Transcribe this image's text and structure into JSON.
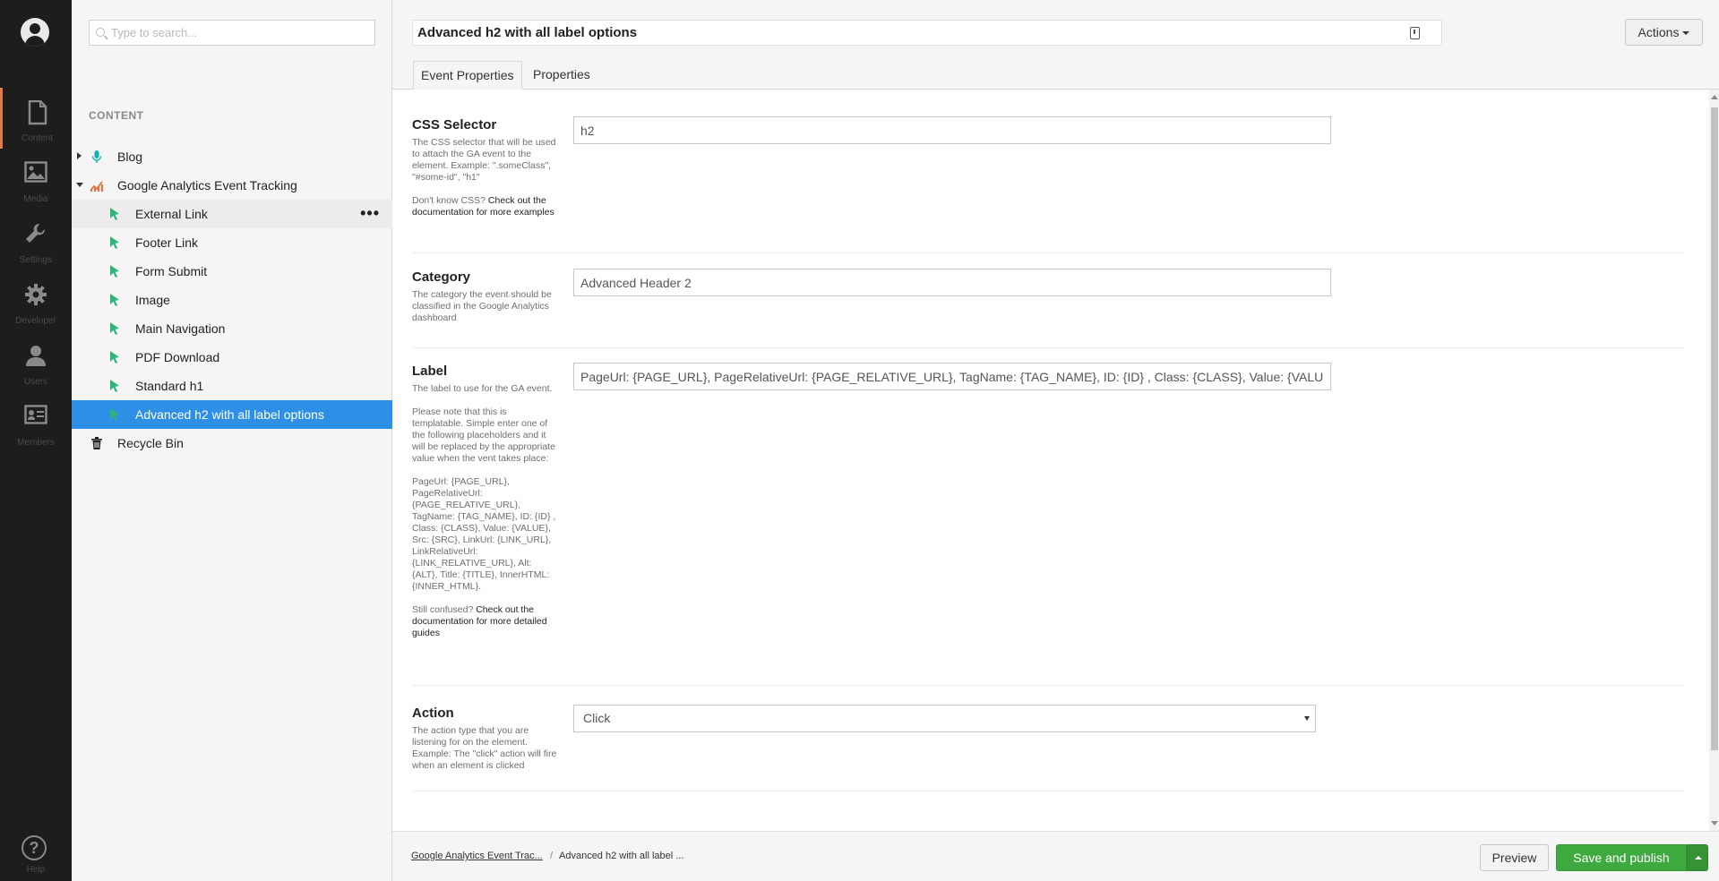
{
  "nav": {
    "items": [
      {
        "label": "Content",
        "icon": "document-icon"
      },
      {
        "label": "Media",
        "icon": "image-icon"
      },
      {
        "label": "Settings",
        "icon": "wrench-icon"
      },
      {
        "label": "Developer",
        "icon": "gear-icon"
      },
      {
        "label": "Users",
        "icon": "user-icon"
      },
      {
        "label": "Members",
        "icon": "id-card-icon"
      }
    ],
    "help_label": "Help",
    "help_glyph": "?"
  },
  "tree": {
    "search_placeholder": "Type to search...",
    "section_title": "CONTENT",
    "nodes": [
      {
        "label": "Blog",
        "icon": "microphone-icon"
      },
      {
        "label": "Google Analytics Event Tracking",
        "icon": "chart-icon"
      },
      {
        "label": "External Link",
        "icon": "cursor-icon"
      },
      {
        "label": "Footer Link",
        "icon": "cursor-icon"
      },
      {
        "label": "Form Submit",
        "icon": "cursor-icon"
      },
      {
        "label": "Image",
        "icon": "cursor-icon"
      },
      {
        "label": "Main Navigation",
        "icon": "cursor-icon"
      },
      {
        "label": "PDF Download",
        "icon": "cursor-icon"
      },
      {
        "label": "Standard h1",
        "icon": "cursor-icon"
      },
      {
        "label": "Advanced h2 with all label options",
        "icon": "cursor-icon"
      },
      {
        "label": "Recycle Bin",
        "icon": "trash-icon"
      }
    ],
    "more_glyph": "•••"
  },
  "header": {
    "title": "Advanced h2 with all label options",
    "actions_label": "Actions"
  },
  "tabs": [
    {
      "label": "Event Properties"
    },
    {
      "label": "Properties"
    }
  ],
  "properties": {
    "css_selector": {
      "label": "CSS Selector",
      "desc1": "The CSS selector that will be used to attach the GA event to the element. Example: \".someClass\", \"#some-id\", \"h1\"",
      "desc2_pre": "Don't know CSS? ",
      "desc2_link": "Check out the documentation for more examples",
      "value": "h2"
    },
    "category": {
      "label": "Category",
      "desc": "The category the event should be classified in the Google Analytics dashboard",
      "value": "Advanced Header 2"
    },
    "label": {
      "label": "Label",
      "desc1": "The label to use for the GA event.",
      "desc2": "Please note that this is templatable. Simple enter one of the following placeholders and it will be replaced by the appropriate value when the vent takes place:",
      "desc3": "PageUrl: {PAGE_URL}, PageRelativeUrl: {PAGE_RELATIVE_URL}, TagName: {TAG_NAME}, ID: {ID} , Class: {CLASS}, Value: {VALUE}, Src: {SRC}, LinkUrl: {LINK_URL}, LinkRelativeUrl: {LINK_RELATIVE_URL}, Alt: {ALT}, Title: {TITLE}, InnerHTML: {INNER_HTML}.",
      "desc4_pre": "Still confused? ",
      "desc4_link": "Check out the documentation for more detailed guides",
      "value": "PageUrl: {PAGE_URL}, PageRelativeUrl: {PAGE_RELATIVE_URL}, TagName: {TAG_NAME}, ID: {ID} , Class: {CLASS}, Value: {VALUE}, S"
    },
    "action": {
      "label": "Action",
      "desc": "The action type that you are listening for on the element. Example: The \"click\" action will fire when an element is clicked",
      "value": "Click"
    }
  },
  "footer": {
    "breadcrumb": [
      "Google Analytics Event Trac...",
      "Advanced h2 with all label ..."
    ],
    "separator": "/",
    "preview_label": "Preview",
    "publish_label": "Save and publish"
  },
  "colors": {
    "rail_bg": "#1d1d1d",
    "accent_orange": "#e0794d",
    "selected_blue": "#2e8fe6",
    "publish_green": "#3ea93e",
    "cursor_green": "#2bb673"
  }
}
